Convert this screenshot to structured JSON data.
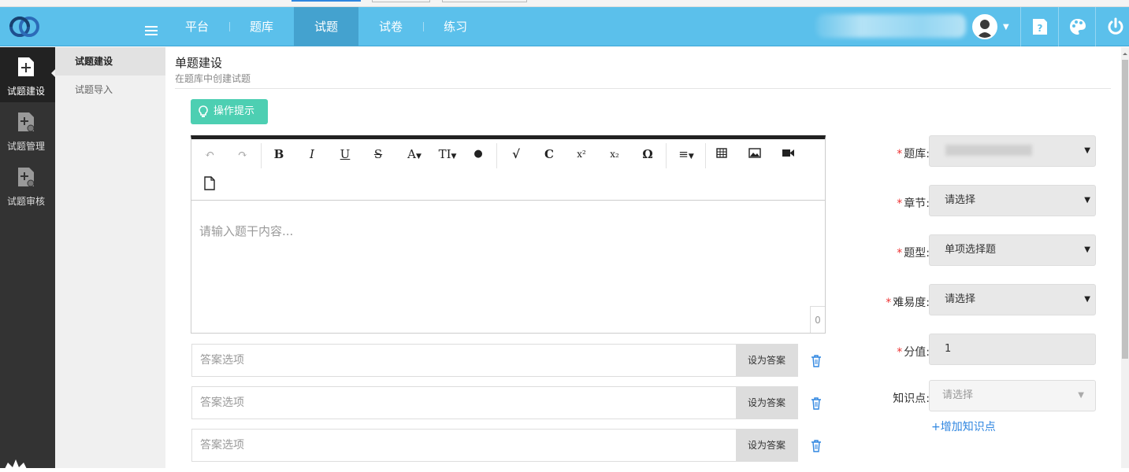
{
  "header": {
    "nav": [
      {
        "label": "平台",
        "active": false
      },
      {
        "label": "题库",
        "active": false
      },
      {
        "label": "试题",
        "active": true
      },
      {
        "label": "试卷",
        "active": false
      },
      {
        "label": "练习",
        "active": false
      }
    ],
    "accent_color": "#5bc0eb",
    "active_nav_color": "#44a2cf",
    "icons": [
      "logo-icon",
      "menu-toggle-icon",
      "avatar",
      "help-icon",
      "palette-icon",
      "power-icon"
    ]
  },
  "sidebar": {
    "items": [
      {
        "label": "试题建设",
        "icon": "add-document-icon",
        "active": true
      },
      {
        "label": "试题管理",
        "icon": "manage-document-icon",
        "active": false
      },
      {
        "label": "试题审核",
        "icon": "review-document-icon",
        "active": false
      }
    ]
  },
  "subnav": {
    "items": [
      {
        "label": "试题建设",
        "active": true
      },
      {
        "label": "试题导入",
        "active": false
      }
    ]
  },
  "main": {
    "title": "单题建设",
    "subtitle": "在题库中创建试题",
    "tip_button": "操作提示",
    "editor": {
      "toolbar": [
        "undo-icon",
        "redo-icon",
        "B",
        "I",
        "U",
        "S",
        "A",
        "TI",
        "color-icon",
        "√",
        "C",
        "x²",
        "x₂",
        "Ω",
        "align-icon",
        "table-icon",
        "image-icon",
        "video-icon",
        "file-icon"
      ],
      "placeholder": "请输入题干内容...",
      "char_count": "0"
    },
    "answers": [
      {
        "placeholder": "答案选项",
        "button": "设为答案"
      },
      {
        "placeholder": "答案选项",
        "button": "设为答案"
      },
      {
        "placeholder": "答案选项",
        "button": "设为答案"
      }
    ]
  },
  "form": {
    "fields": [
      {
        "label": "题库:",
        "required": true,
        "value": ""
      },
      {
        "label": "章节:",
        "required": true,
        "value": "请选择"
      },
      {
        "label": "题型:",
        "required": true,
        "value": "单项选择题"
      },
      {
        "label": "难易度:",
        "required": true,
        "value": "请选择"
      },
      {
        "label": "分值:",
        "required": true,
        "value": "1"
      },
      {
        "label": "知识点:",
        "required": false,
        "value": "请选择"
      }
    ],
    "add_point": "+增加知识点",
    "required_color": "#e33333",
    "link_color": "#2f86e0"
  }
}
